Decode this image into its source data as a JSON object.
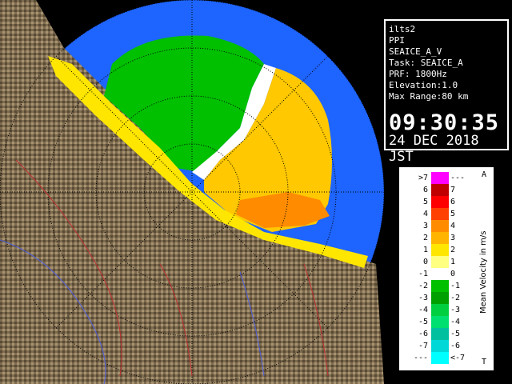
{
  "info": {
    "radar_name": "ilts2",
    "scan_mode": "PPI",
    "product": "SEAICE_A_V",
    "task": "Task: SEAICE_A",
    "prf": "PRF: 1800Hz",
    "elevation": "Elevation:1.0",
    "max_range": "Max Range:80 km",
    "time": "09:30:35",
    "date": "24 DEC 2018 JST"
  },
  "legend": {
    "title": "Mean Velocity in m/s",
    "top_mark": "A",
    "bottom_mark": "T",
    "rows": [
      {
        "left": ">7",
        "right": "---",
        "color": "#ff00ff"
      },
      {
        "left": "6",
        "right": "7",
        "color": "#c00000"
      },
      {
        "left": "5",
        "right": "6",
        "color": "#ff0000"
      },
      {
        "left": "4",
        "right": "5",
        "color": "#ff4000"
      },
      {
        "left": "3",
        "right": "4",
        "color": "#ff8c00"
      },
      {
        "left": "2",
        "right": "3",
        "color": "#ffb400"
      },
      {
        "left": "1",
        "right": "2",
        "color": "#ffe600"
      },
      {
        "left": "0",
        "right": "1",
        "color": "#ffff80"
      },
      {
        "left": "-1",
        "right": "0",
        "color": "#ffffff"
      },
      {
        "left": "-2",
        "right": "-1",
        "color": "#00c000"
      },
      {
        "left": "-3",
        "right": "-2",
        "color": "#00a000"
      },
      {
        "left": "-4",
        "right": "-3",
        "color": "#00d040"
      },
      {
        "left": "-5",
        "right": "-4",
        "color": "#00e070"
      },
      {
        "left": "-6",
        "right": "-5",
        "color": "#00c0a0"
      },
      {
        "left": "-7",
        "right": "-6",
        "color": "#00d8d8"
      },
      {
        "left": "---",
        "right": "<-7",
        "color": "#00ffff"
      }
    ]
  },
  "colors": {
    "sea": "#1e64ff",
    "land": "#7a6a50",
    "range_ring": "#000000"
  }
}
